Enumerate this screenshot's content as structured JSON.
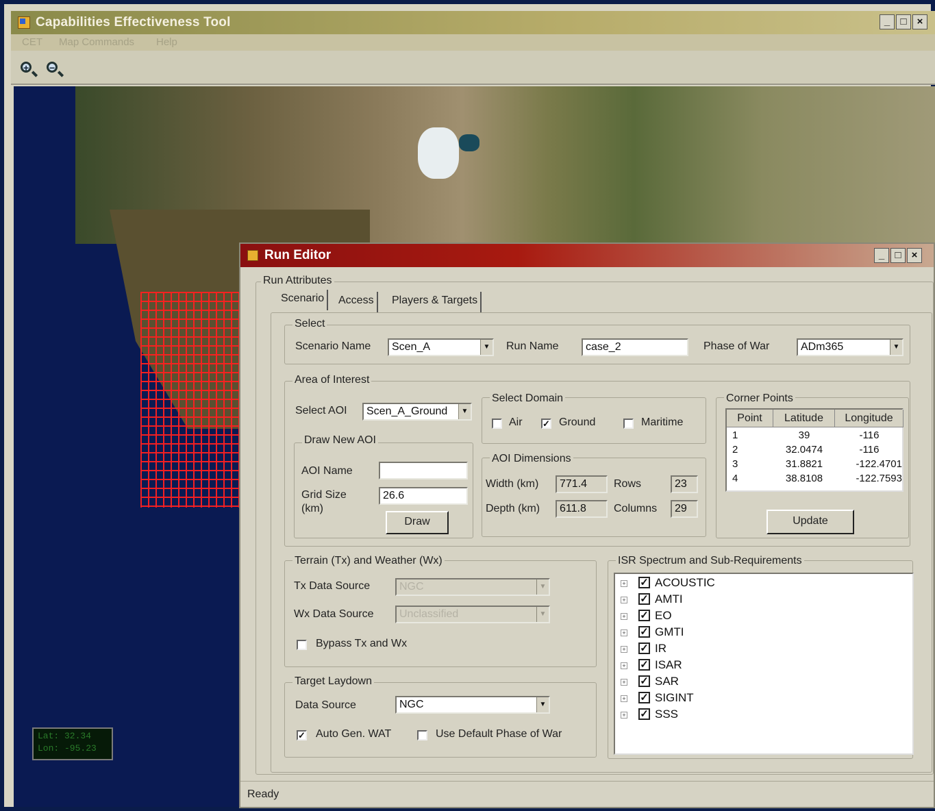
{
  "app": {
    "title": "Capabilities Effectiveness Tool",
    "window_buttons": [
      "_",
      "□",
      "×"
    ],
    "menu": [
      "CET",
      "Map Commands",
      "Help"
    ],
    "toolbar": {
      "zoom_in_icon": "zoom-in-icon",
      "zoom_out_icon": "zoom-out-icon",
      "zoom_in_glyph": "+",
      "zoom_out_glyph": "−"
    }
  },
  "map": {
    "coords": {
      "lat": "Lat: 32.34",
      "lon": "Lon: -95.23"
    },
    "grid_color": "#ff2020"
  },
  "editor": {
    "title": "Run Editor",
    "window_buttons": [
      "_",
      "□",
      "×"
    ],
    "run_attributes_label": "Run Attributes",
    "tabs": [
      "Scenario",
      "Access",
      "Players & Targets"
    ],
    "select": {
      "group_label": "Select",
      "scenario_name_label": "Scenario Name",
      "scenario_name_value": "Scen_A",
      "run_name_label": "Run Name",
      "run_name_value": "case_2",
      "phase_label": "Phase of War",
      "phase_value": "ADm365"
    },
    "aoi": {
      "group_label": "Area of Interest",
      "select_aoi_label": "Select AOI",
      "select_aoi_value": "Scen_A_Ground",
      "draw_new_label": "Draw New AOI",
      "aoi_name_label": "AOI Name",
      "aoi_name_value": "",
      "grid_size_label": "Grid Size",
      "grid_size_unit": "(km)",
      "grid_size_value": "26.6",
      "draw_button": "Draw",
      "domain_label": "Select Domain",
      "domain_air": "Air",
      "domain_ground": "Ground",
      "domain_maritime": "Maritime",
      "domain_air_checked": false,
      "domain_ground_checked": true,
      "domain_maritime_checked": false,
      "dims_label": "AOI Dimensions",
      "width_label": "Width (km)",
      "width_value": "771.4",
      "depth_label": "Depth (km)",
      "depth_value": "611.8",
      "rows_label": "Rows",
      "rows_value": "23",
      "cols_label": "Columns",
      "cols_value": "29",
      "corner_label": "Corner Points",
      "corner_headers": [
        "Point",
        "Latitude",
        "Longitude"
      ],
      "corner_rows": [
        [
          "1",
          "39",
          "-116"
        ],
        [
          "2",
          "32.0474",
          "-116"
        ],
        [
          "3",
          "31.8821",
          "-122.4701"
        ],
        [
          "4",
          "38.8108",
          "-122.7593"
        ]
      ],
      "update_button": "Update"
    },
    "terrain": {
      "group_label": "Terrain (Tx) and Weather (Wx)",
      "tx_label": "Tx Data Source",
      "tx_value": "NGC",
      "wx_label": "Wx Data Source",
      "wx_value": "Unclassified",
      "bypass_label": "Bypass Tx and Wx",
      "bypass_checked": false
    },
    "target": {
      "group_label": "Target Laydown",
      "source_label": "Data Source",
      "source_value": "NGC",
      "autogen_label": "Auto Gen. WAT",
      "autogen_checked": true,
      "default_phase_label": "Use Default Phase of War",
      "default_phase_checked": false
    },
    "isr": {
      "group_label": "ISR Spectrum and Sub-Requirements",
      "items": [
        "ACOUSTIC",
        "AMTI",
        "EO",
        "GMTI",
        "IR",
        "ISAR",
        "SAR",
        "SIGINT",
        "SSS"
      ],
      "expand_glyph": "+",
      "check_glyph": "✓"
    },
    "status": "Ready"
  }
}
